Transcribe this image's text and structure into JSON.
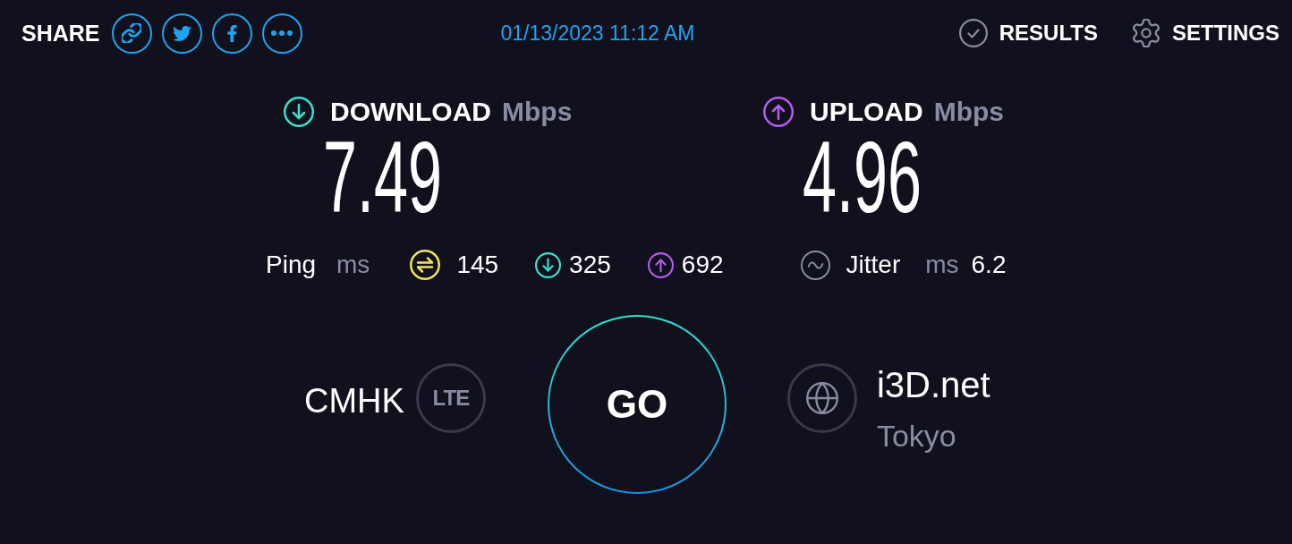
{
  "share": {
    "label": "SHARE"
  },
  "datetime": "01/13/2023 11:12 AM",
  "nav": [
    {
      "kind": "results",
      "label": "RESULTS"
    },
    {
      "kind": "settings",
      "label": "SETTINGS"
    }
  ],
  "speeds": [
    {
      "kind": "download",
      "label": "DOWNLOAD",
      "unit": "Mbps",
      "value": "7.49"
    },
    {
      "kind": "upload",
      "label": "UPLOAD",
      "unit": "Mbps",
      "value": "4.96"
    }
  ],
  "ping": {
    "label": "Ping",
    "unit": "ms",
    "readings": [
      {
        "kind": "idle",
        "value": "145"
      },
      {
        "kind": "download",
        "value": "325"
      },
      {
        "kind": "upload",
        "value": "692"
      }
    ]
  },
  "jitter": {
    "label": "Jitter",
    "unit": "ms",
    "value": "6.2"
  },
  "provider": {
    "name": "CMHK",
    "connection": "LTE"
  },
  "go_button": {
    "label": "GO"
  },
  "server": {
    "name": "i3D.net",
    "location": "Tokyo"
  }
}
